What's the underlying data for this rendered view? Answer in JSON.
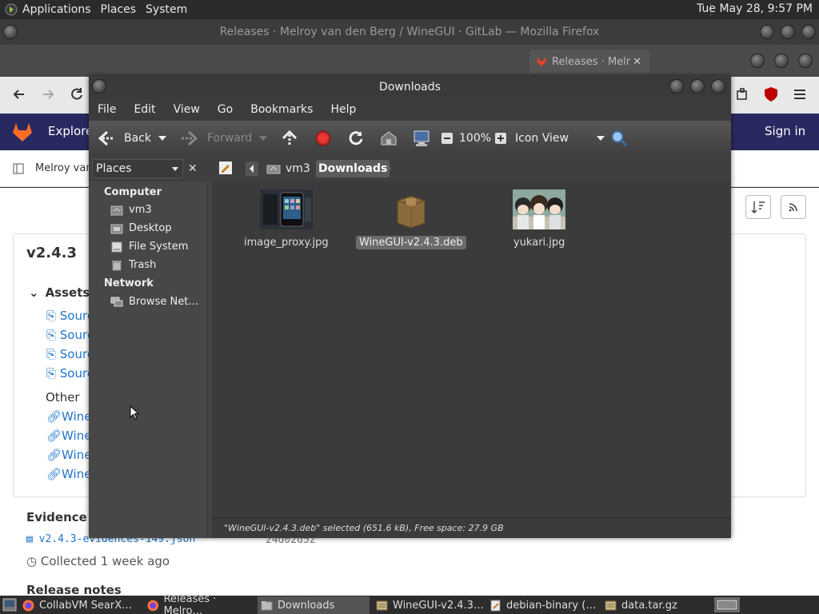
{
  "top_panel": {
    "menus": [
      "Applications",
      "Places",
      "System"
    ],
    "clock": "Tue May 28,  9:57 PM"
  },
  "firefox": {
    "title": "Releases · Melroy van den Berg / WineGUI · GitLab — Mozilla Firefox",
    "active_tab": "Releases · Melr",
    "explore": "Explore",
    "sign_in": "Sign in",
    "breadcrumb": "Melroy van",
    "release_title": "v2.4.3",
    "assets": "Assets",
    "source_links": [
      "Sourc",
      "Sourc",
      "Sourc",
      "Sourc"
    ],
    "other": "Other",
    "wine_links": [
      "Wine",
      "Wine",
      "Wine",
      "Wine"
    ],
    "evidence": "Evidence co",
    "evidence_file": "v2.4.3-evidences-149.json",
    "evidence_hash": "24d02d52",
    "collected": "Collected 1 week ago",
    "release_notes": "Release notes"
  },
  "nautilus": {
    "title": "Downloads",
    "menu": [
      "File",
      "Edit",
      "View",
      "Go",
      "Bookmarks",
      "Help"
    ],
    "toolbar": {
      "back": "Back",
      "forward": "Forward",
      "zoom": "100%",
      "view_mode": "Icon View"
    },
    "sidebar_combo": "Places",
    "path": [
      "vm3",
      "Downloads"
    ],
    "sidebar": {
      "computer_heading": "Computer",
      "computer_items": [
        "vm3",
        "Desktop",
        "File System",
        "Trash"
      ],
      "network_heading": "Network",
      "network_items": [
        "Browse Net…"
      ]
    },
    "files": [
      {
        "name": "image_proxy.jpg",
        "selected": false
      },
      {
        "name": "WineGUI-v2.4.3.deb",
        "selected": true
      },
      {
        "name": "yukari.jpg",
        "selected": false
      }
    ],
    "status": "\"WineGUI-v2.4.3.deb\" selected (651.6 kB), Free space: 27.9 GB"
  },
  "taskbar": [
    {
      "label": "CollabVM SearX…",
      "active": false
    },
    {
      "label": "Releases · Melro…",
      "active": false
    },
    {
      "label": "Downloads",
      "active": true
    },
    {
      "label": "WineGUI-v2.4.3…",
      "active": false
    },
    {
      "label": "debian-binary (…",
      "active": false
    },
    {
      "label": "data.tar.gz",
      "active": false
    }
  ],
  "colors": {
    "gitlab_header": "#292961",
    "gitlab_link": "#1f75cb",
    "nautilus_bg": "#3b3b3b",
    "selection": "#6b6b6b"
  }
}
